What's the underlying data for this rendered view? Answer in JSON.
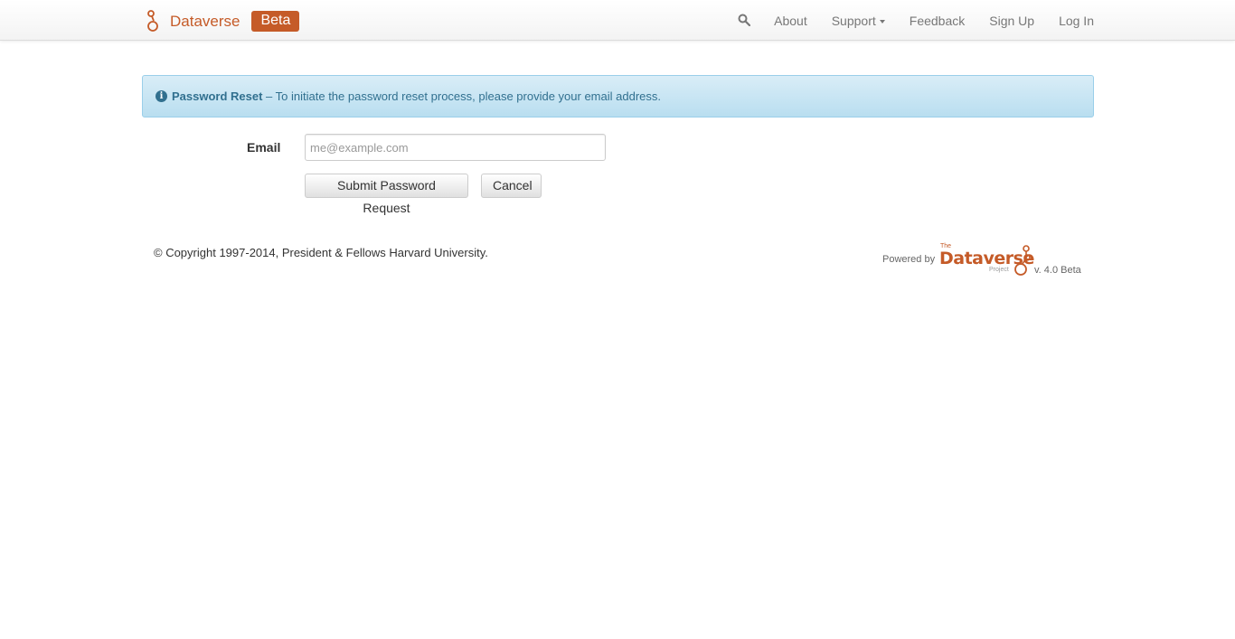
{
  "navbar": {
    "brand": "Dataverse",
    "badge": "Beta",
    "links": {
      "about": "About",
      "support": "Support",
      "feedback": "Feedback",
      "signup": "Sign Up",
      "login": "Log In"
    },
    "search_icon": "search-icon"
  },
  "alert": {
    "title": "Password Reset",
    "message": " – To initiate the password reset process, please provide your email address.",
    "icon": "info-icon"
  },
  "form": {
    "email_label": "Email",
    "email_placeholder": "me@example.com",
    "email_value": "",
    "submit_label": "Submit Password Request",
    "cancel_label": "Cancel"
  },
  "footer": {
    "copyright": "© Copyright 1997-2014, President & Fellows Harvard University.",
    "powered_by": "Powered by",
    "logo_the": "The",
    "logo_name": "Dataverse",
    "logo_project": "Project",
    "version": "v. 4.0 Beta"
  },
  "colors": {
    "brand": "#c55b28",
    "alert_text": "#31708f",
    "alert_bg": "#d9edf7"
  }
}
